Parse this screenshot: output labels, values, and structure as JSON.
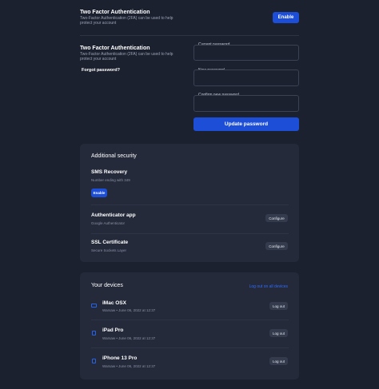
{
  "two_factor_top": {
    "title": "Two Factor Authentication",
    "description_line1": "Two-Factor Authentication (2FA) can be used to help",
    "description_line2": "protect your account",
    "button": "Enable"
  },
  "password_section": {
    "title": "Two Factor Authentication",
    "description_line1": "Two-Factor Authentication (2FA) can be used to help",
    "description_line2": "protect your account",
    "forgot_link": "Forgot password?",
    "current_label": "Current password",
    "new_label": "New password",
    "confirm_label": "Confirm new password",
    "update_button": "Update password"
  },
  "additional_security": {
    "title": "Additional security",
    "sms": {
      "title": "SMS Recovery",
      "subtitle": "Number ending with 349",
      "button": "Enable"
    },
    "authenticator": {
      "title": "Authenticator app",
      "subtitle": "Google Authenticator",
      "button": "Configure"
    },
    "ssl": {
      "title": "SSL Certificate",
      "subtitle": "Secure Sockets Layer",
      "button": "Configure"
    }
  },
  "devices": {
    "title": "Your devices",
    "logout_all": "Log out on all devices",
    "items": [
      {
        "name": "iMac OSX",
        "detail": "Warsaw • June 06, 2022 at 12:37",
        "button": "Log out",
        "icon": "desktop-icon"
      },
      {
        "name": "iPad Pro",
        "detail": "Warsaw • June 06, 2022 at 12:37",
        "button": "Log out",
        "icon": "tablet-icon"
      },
      {
        "name": "iPhone 13 Pro",
        "detail": "Warsaw • June 06, 2022 at 12:37",
        "button": "Log out",
        "icon": "phone-icon"
      }
    ]
  },
  "colors": {
    "background": "#1c2130",
    "card": "#242a3a",
    "accent": "#1d4ed8",
    "link": "#2f6bff"
  }
}
